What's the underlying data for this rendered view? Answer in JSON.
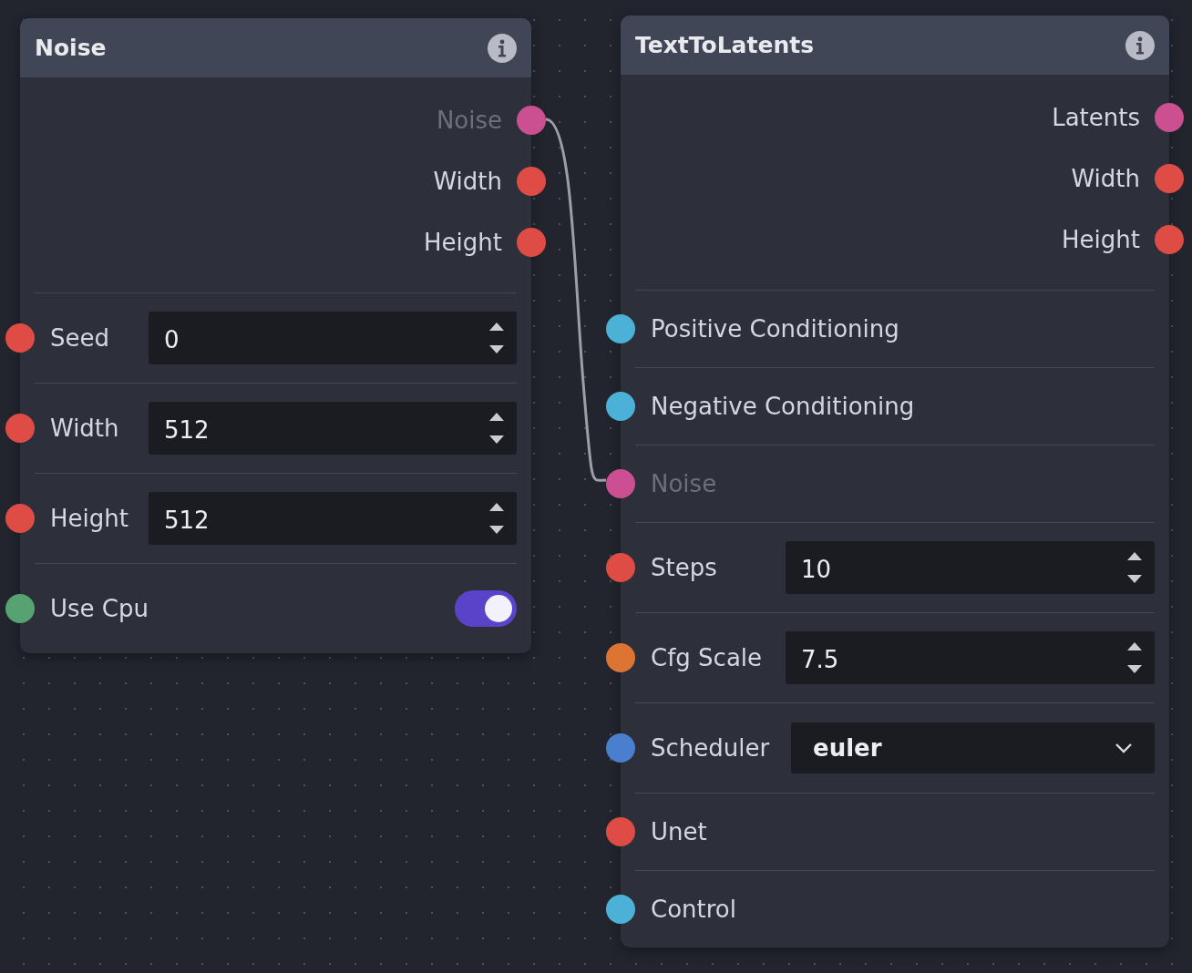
{
  "nodes": [
    {
      "title": "Noise",
      "outputs": [
        {
          "label": "Noise",
          "color": "#cc4f92",
          "connected": true
        },
        {
          "label": "Width",
          "color": "#df4c45",
          "connected": false
        },
        {
          "label": "Height",
          "color": "#df4c45",
          "connected": false
        }
      ],
      "inputs": [
        {
          "label": "Seed",
          "kind": "number",
          "value": "0",
          "color": "#df4c45",
          "connected": false
        },
        {
          "label": "Width",
          "kind": "number",
          "value": "512",
          "color": "#df4c45",
          "connected": false
        },
        {
          "label": "Height",
          "kind": "number",
          "value": "512",
          "color": "#df4c45",
          "connected": false
        },
        {
          "label": "Use Cpu",
          "kind": "toggle",
          "on": true,
          "color": "#57a271",
          "connected": false
        }
      ]
    },
    {
      "title": "TextToLatents",
      "outputs": [
        {
          "label": "Latents",
          "color": "#cc4f92",
          "connected": false
        },
        {
          "label": "Width",
          "color": "#df4c45",
          "connected": false
        },
        {
          "label": "Height",
          "color": "#df4c45",
          "connected": false
        }
      ],
      "inputs": [
        {
          "label": "Positive Conditioning",
          "kind": "link",
          "color": "#4cb1d6",
          "connected": false
        },
        {
          "label": "Negative Conditioning",
          "kind": "link",
          "color": "#4cb1d6",
          "connected": false
        },
        {
          "label": "Noise",
          "kind": "link",
          "color": "#cc4f92",
          "connected": true
        },
        {
          "label": "Steps",
          "kind": "number",
          "value": "10",
          "color": "#df4c45",
          "connected": false
        },
        {
          "label": "Cfg Scale",
          "kind": "number",
          "value": "7.5",
          "color": "#dd7434",
          "connected": false
        },
        {
          "label": "Scheduler",
          "kind": "select",
          "value": "euler",
          "color": "#4a7fd0",
          "connected": false
        },
        {
          "label": "Unet",
          "kind": "link",
          "color": "#df4c45",
          "connected": false
        },
        {
          "label": "Control",
          "kind": "link",
          "color": "#4cb1d6",
          "connected": false
        }
      ]
    }
  ]
}
